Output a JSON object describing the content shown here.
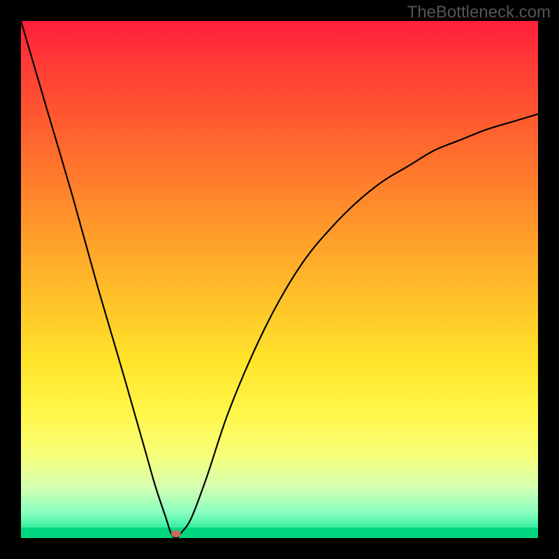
{
  "attribution": "TheBottleneck.com",
  "chart_data": {
    "type": "line",
    "title": "",
    "xlabel": "",
    "ylabel": "",
    "xlim": [
      0,
      100
    ],
    "ylim": [
      0,
      100
    ],
    "series": [
      {
        "name": "bottleneck-curve",
        "x": [
          0,
          5,
          10,
          15,
          20,
          24,
          26,
          28,
          29,
          30,
          31,
          33,
          36,
          40,
          45,
          50,
          55,
          60,
          65,
          70,
          75,
          80,
          85,
          90,
          95,
          100
        ],
        "values": [
          100,
          83,
          66,
          48,
          31,
          17,
          10,
          4,
          1,
          0,
          1,
          4,
          12,
          24,
          36,
          46,
          54,
          60,
          65,
          69,
          72,
          75,
          77,
          79,
          80.5,
          82
        ]
      }
    ],
    "marker": {
      "x": 30,
      "y": 0,
      "color": "#c96a5a"
    },
    "gradient": {
      "top": "#ff1f3a",
      "mid": "#ffe42a",
      "bottom": "#00e28a"
    }
  }
}
